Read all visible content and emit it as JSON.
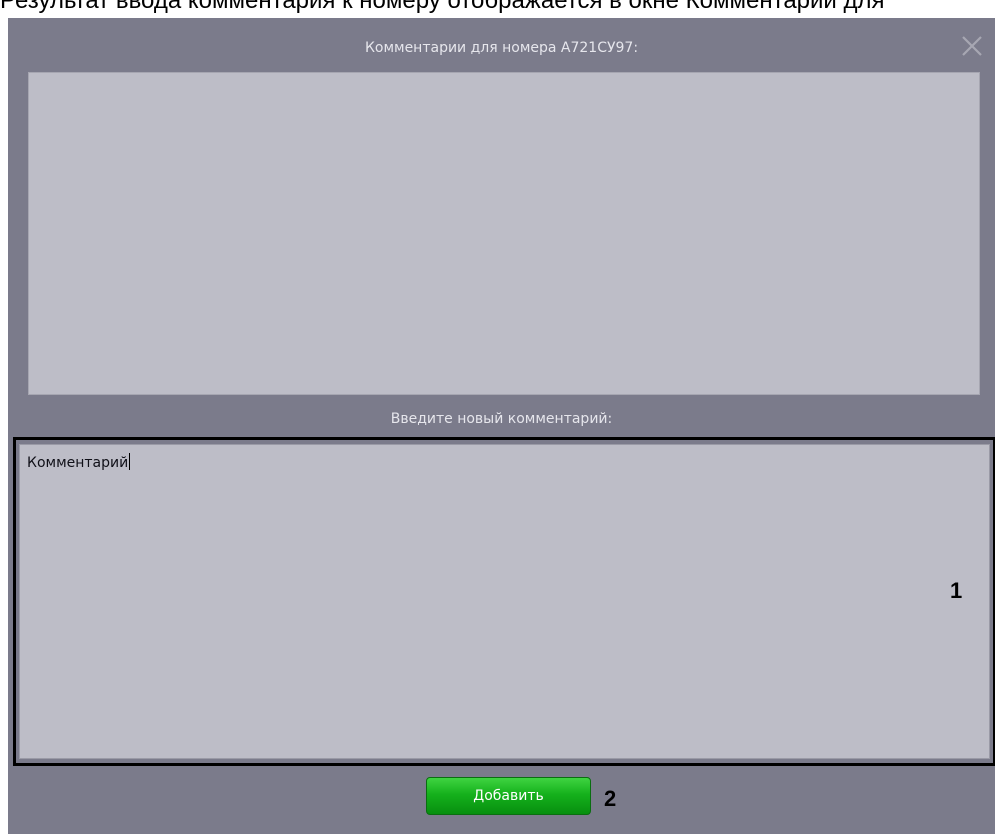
{
  "page_caption_partial": "Результат ввода комментария к номеру отображается в окне Комментарии для",
  "dialog": {
    "title": "Комментарии для номера А721СУ97:",
    "close_icon": "close-icon",
    "existing_comments_text": "",
    "new_comment_label": "Введите новый комментарий:",
    "new_comment_value": "Комментарий",
    "add_button_label": "Добавить"
  },
  "callouts": {
    "input_marker": "1",
    "button_marker": "2"
  },
  "colors": {
    "dialog_background": "#7b7b8b",
    "field_background": "#bdbdc7",
    "button_green": "#15b11c",
    "highlight_border": "#000000"
  }
}
